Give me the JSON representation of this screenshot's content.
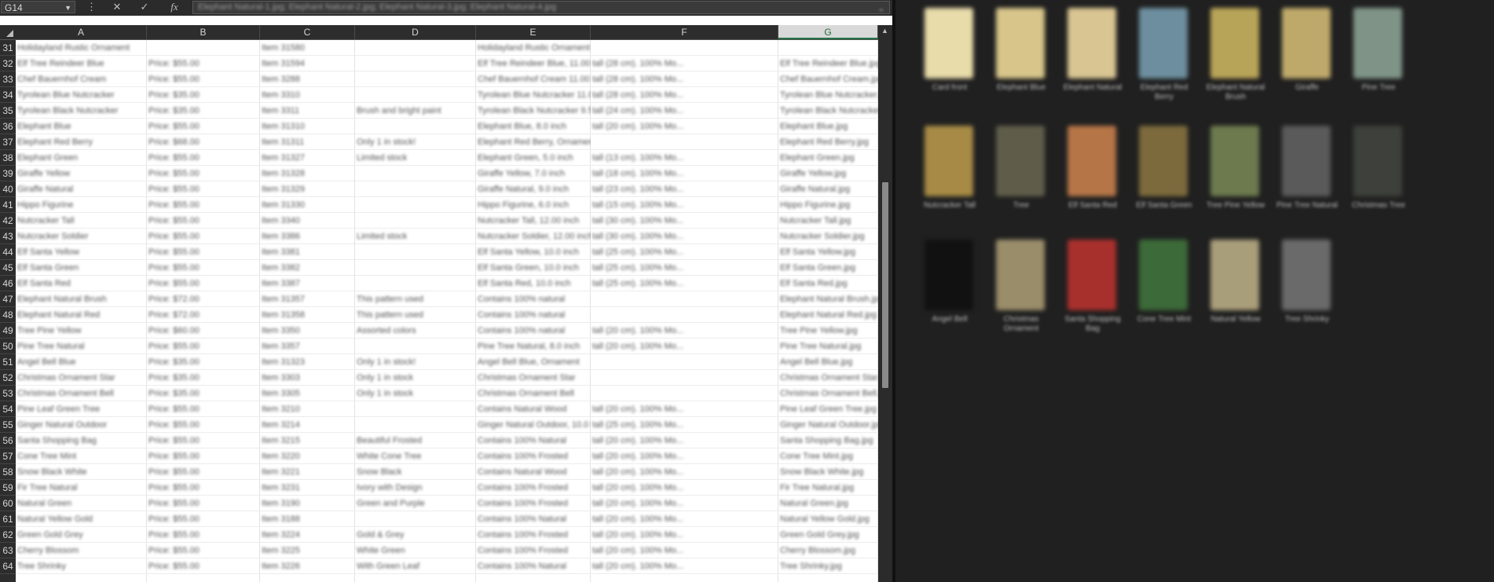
{
  "excel": {
    "name_box": "G14",
    "fx_label": "fx",
    "formula_value": "Elephant Natural-1.jpg; Elephant Natural-2.jpg; Elephant Natural-3.jpg; Elephant Natural-4.jpg",
    "columns": [
      "A",
      "B",
      "C",
      "D",
      "E",
      "F",
      "G"
    ],
    "active_column": "G",
    "rows": [
      "31",
      "32",
      "33",
      "34",
      "35",
      "36",
      "37",
      "38",
      "39",
      "40",
      "41",
      "42",
      "43",
      "44",
      "45",
      "46",
      "47",
      "48",
      "49",
      "50",
      "51",
      "52",
      "53",
      "54",
      "55",
      "56",
      "57",
      "58",
      "59",
      "60",
      "61",
      "62",
      "63",
      "64"
    ],
    "cells": [
      [
        "Holidayland Rustic Ornament",
        "",
        "Item 31580",
        "",
        "Holidayland Rustic Ornament",
        "",
        ""
      ],
      [
        "Elf Tree Reindeer Blue",
        "Price: $55.00",
        "Item 31594",
        "",
        "Elf Tree Reindeer Blue, 11.00 inch",
        "tall (28 cm). 100% Mo...",
        "Elf Tree Reindeer Blue.jpg"
      ],
      [
        "Chef Bauernhof Cream",
        "Price: $55.00",
        "Item 3288",
        "",
        "Chef Bauernhof Cream 11.00 inch",
        "tall (28 cm). 100% Mo...",
        "Chef Bauernhof Cream.jpg"
      ],
      [
        "Tyrolean Blue Nutcracker",
        "Price: $35.00",
        "Item 3310",
        "",
        "Tyrolean Blue Nutcracker 11.00 inch",
        "tall (28 cm). 100% Mo...",
        "Tyrolean Blue Nutcracker.jpg"
      ],
      [
        "Tyrolean Black Nutcracker",
        "Price: $35.00",
        "Item 3311",
        "Brush and bright paint",
        "Tyrolean Black Nutcracker 9.5 inch",
        "tall (24 cm). 100% Mo...",
        "Tyrolean Black Nutcracker.jpg"
      ],
      [
        "Elephant Blue",
        "Price: $55.00",
        "Item 31310",
        "",
        "Elephant Blue, 8.0 inch",
        "tall (20 cm). 100% Mo...",
        "Elephant Blue.jpg"
      ],
      [
        "Elephant Red Berry",
        "Price: $68.00",
        "Item 31311",
        "Only 1 in stock!",
        "Elephant Red Berry, Ornament",
        "",
        "Elephant Red Berry.jpg"
      ],
      [
        "Elephant Green",
        "Price: $55.00",
        "Item 31327",
        "Limited stock",
        "Elephant Green, 5.0 inch",
        "tall (13 cm). 100% Mo...",
        "Elephant Green.jpg"
      ],
      [
        "Giraffe Yellow",
        "Price: $55.00",
        "Item 31328",
        "",
        "Giraffe Yellow, 7.0 inch",
        "tall (18 cm). 100% Mo...",
        "Giraffe Yellow.jpg"
      ],
      [
        "Giraffe Natural",
        "Price: $55.00",
        "Item 31329",
        "",
        "Giraffe Natural, 9.0 inch",
        "tall (23 cm). 100% Mo...",
        "Giraffe Natural.jpg"
      ],
      [
        "Hippo Figurine",
        "Price: $55.00",
        "Item 31330",
        "",
        "Hippo Figurine, 6.0 inch",
        "tall (15 cm). 100% Mo...",
        "Hippo Figurine.jpg"
      ],
      [
        "Nutcracker Tall",
        "Price: $55.00",
        "Item 3340",
        "",
        "Nutcracker Tall, 12.00 inch",
        "tall (30 cm). 100% Mo...",
        "Nutcracker Tall.jpg"
      ],
      [
        "Nutcracker Soldier",
        "Price: $55.00",
        "Item 3386",
        "Limited stock",
        "Nutcracker Soldier, 12.00 inch",
        "tall (30 cm). 100% Mo...",
        "Nutcracker Soldier.jpg"
      ],
      [
        "Elf Santa Yellow",
        "Price: $55.00",
        "Item 3381",
        "",
        "Elf Santa Yellow, 10.0 inch",
        "tall (25 cm). 100% Mo...",
        "Elf Santa Yellow.jpg"
      ],
      [
        "Elf Santa Green",
        "Price: $55.00",
        "Item 3382",
        "",
        "Elf Santa Green, 10.0 inch",
        "tall (25 cm). 100% Mo...",
        "Elf Santa Green.jpg"
      ],
      [
        "Elf Santa Red",
        "Price: $55.00",
        "Item 3387",
        "",
        "Elf Santa Red, 10.0 inch",
        "tall (25 cm). 100% Mo...",
        "Elf Santa Red.jpg"
      ],
      [
        "Elephant Natural Brush",
        "Price: $72.00",
        "Item 31357",
        "This pattern used",
        "Contains 100% natural",
        "",
        "Elephant Natural Brush.jpg"
      ],
      [
        "Elephant Natural Red",
        "Price: $72.00",
        "Item 31358",
        "This pattern used",
        "Contains 100% natural",
        "",
        "Elephant Natural Red.jpg"
      ],
      [
        "Tree Pine Yellow",
        "Price: $60.00",
        "Item 3350",
        "Assorted colors",
        "Contains 100% natural",
        "tall (20 cm). 100% Mo...",
        "Tree Pine Yellow.jpg"
      ],
      [
        "Pine Tree Natural",
        "Price: $55.00",
        "Item 3357",
        "",
        "Pine Tree Natural, 8.0 inch",
        "tall (20 cm). 100% Mo...",
        "Pine Tree Natural.jpg"
      ],
      [
        "Angel Bell Blue",
        "Price: $35.00",
        "Item 31323",
        "Only 1 in stock!",
        "Angel Bell Blue, Ornament",
        "",
        "Angel Bell Blue.jpg"
      ],
      [
        "Christmas Ornament Star",
        "Price: $35.00",
        "Item 3303",
        "Only 1 in stock",
        "Christmas Ornament Star",
        "",
        "Christmas Ornament Star.jpg"
      ],
      [
        "Christmas Ornament Bell",
        "Price: $35.00",
        "Item 3305",
        "Only 1 in stock",
        "Christmas Ornament Bell",
        "",
        "Christmas Ornament Bell.jpg"
      ],
      [
        "Pine Leaf Green Tree",
        "Price: $55.00",
        "Item 3210",
        "",
        "Contains Natural Wood",
        "tall (20 cm). 100% Mo...",
        "Pine Leaf Green Tree.jpg"
      ],
      [
        "Ginger Natural Outdoor",
        "Price: $55.00",
        "Item 3214",
        "",
        "Ginger Natural Outdoor, 10.0 inch",
        "tall (25 cm). 100% Mo...",
        "Ginger Natural Outdoor.jpg"
      ],
      [
        "Santa Shopping Bag",
        "Price: $55.00",
        "Item 3215",
        "Beautiful Frosted",
        "Contains 100% Natural",
        "tall (20 cm). 100% Mo...",
        "Santa Shopping Bag.jpg"
      ],
      [
        "Cone Tree Mint",
        "Price: $55.00",
        "Item 3220",
        "White Cone Tree",
        "Contains 100% Frosted",
        "tall (20 cm). 100% Mo...",
        "Cone Tree Mint.jpg"
      ],
      [
        "Snow Black White",
        "Price: $55.00",
        "Item 3221",
        "Snow Black",
        "Contains Natural Wood",
        "tall (20 cm). 100% Mo...",
        "Snow Black White.jpg"
      ],
      [
        "Fir Tree Natural",
        "Price: $55.00",
        "Item 3231",
        "Ivory with Design",
        "Contains 100% Frosted",
        "tall (20 cm). 100% Mo...",
        "Fir Tree Natural.jpg"
      ],
      [
        "Natural Green",
        "Price: $55.00",
        "Item 3190",
        "Green and Purple",
        "Contains 100% Frosted",
        "tall (20 cm). 100% Mo...",
        "Natural Green.jpg"
      ],
      [
        "Natural Yellow Gold",
        "Price: $55.00",
        "Item 3188",
        "",
        "Contains 100% Natural",
        "tall (20 cm). 100% Mo...",
        "Natural Yellow Gold.jpg"
      ],
      [
        "Green Gold Grey",
        "Price: $55.00",
        "Item 3224",
        "Gold & Grey",
        "Contains 100% Frosted",
        "tall (20 cm). 100% Mo...",
        "Green Gold Grey.jpg"
      ],
      [
        "Cherry Blossom",
        "Price: $55.00",
        "Item 3225",
        "White Green",
        "Contains 100% Frosted",
        "tall (20 cm). 100% Mo...",
        "Cherry Blossom.jpg"
      ],
      [
        "Tree Shrinky",
        "Price: $55.00",
        "Item 3226",
        "With Green Leaf",
        "Contains 100% Natural",
        "tall (20 cm). 100% Mo...",
        "Tree Shrinky.jpg"
      ]
    ]
  },
  "explorer": {
    "items": [
      {
        "caption": "Card front",
        "color": "#e8dcaa"
      },
      {
        "caption": "Elephant Blue",
        "color": "#d7c58a"
      },
      {
        "caption": "Elephant Natural",
        "color": "#d9c592"
      },
      {
        "caption": "Elephant Red Berry",
        "color": "#6d8e9e"
      },
      {
        "caption": "Elephant Natural Brush",
        "color": "#b8a458"
      },
      {
        "caption": "Giraffe",
        "color": "#bfa96a"
      },
      {
        "caption": "Pine Tree",
        "color": "#7f9487"
      },
      {
        "caption": "Nutcracker Tall",
        "color": "#a68a45"
      },
      {
        "caption": "Tree",
        "color": "#5f5d4a"
      },
      {
        "caption": "Elf Santa Red",
        "color": "#b57547"
      },
      {
        "caption": "Elf Santa Green",
        "color": "#7c6a3d"
      },
      {
        "caption": "Tree Pine Yellow",
        "color": "#6c7a4e"
      },
      {
        "caption": "Pine Tree Natural",
        "color": "#5a5a5a"
      },
      {
        "caption": "Christmas Tree",
        "color": "#3e403b"
      },
      {
        "caption": "Angel Bell",
        "color": "#111111"
      },
      {
        "caption": "Christmas Ornament",
        "color": "#9a8d6a"
      },
      {
        "caption": "Santa Shopping Bag",
        "color": "#a8302c"
      },
      {
        "caption": "Cone Tree Mint",
        "color": "#3c6a38"
      },
      {
        "caption": "Natural Yellow",
        "color": "#a99e7a"
      },
      {
        "caption": "Tree Shrinky",
        "color": "#6a6a6a"
      }
    ]
  }
}
